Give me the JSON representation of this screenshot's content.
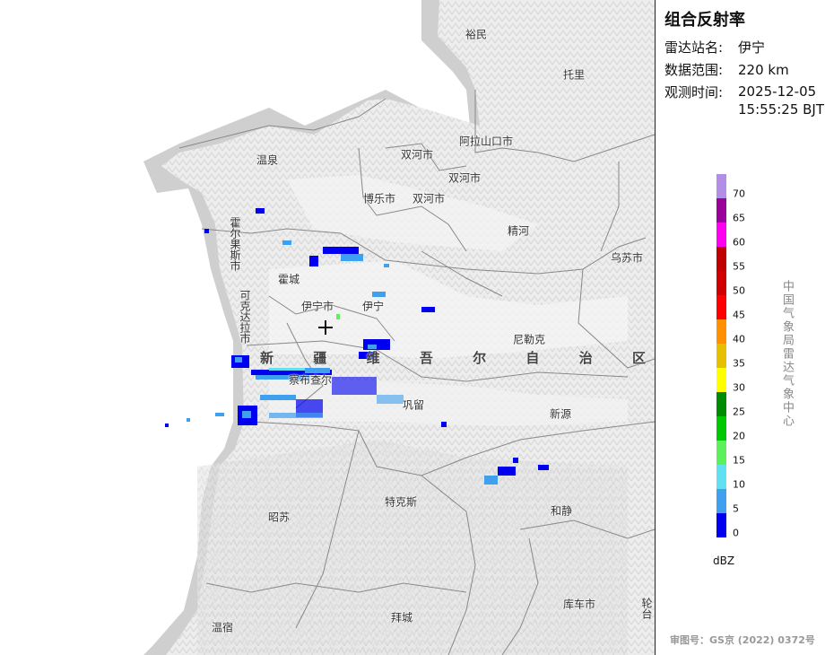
{
  "panel": {
    "title": "组合反射率",
    "station_label": "雷达站名:",
    "station_value": "伊宁",
    "range_label": "数据范围:",
    "range_value": "220 km",
    "time_label": "观测时间:",
    "time_date": "2025-12-05",
    "time_clock": "15:55:25 BJT",
    "unit": "dBZ",
    "organization": "中国气象局雷达气象中心",
    "approval": "审图号：GS京 (2022) 0372号"
  },
  "legend": {
    "ticks": [
      "70",
      "65",
      "60",
      "55",
      "50",
      "45",
      "40",
      "35",
      "30",
      "25",
      "20",
      "15",
      "10",
      "5",
      "0"
    ],
    "colors": [
      "#b28ee6",
      "#9a009a",
      "#ff00f0",
      "#c00000",
      "#d00000",
      "#ff0000",
      "#ff9000",
      "#e6c000",
      "#ffff00",
      "#008c00",
      "#00c800",
      "#5cf05c",
      "#60e0f0",
      "#40a0f0",
      "#0000f0"
    ]
  },
  "map": {
    "places": [
      "裕民",
      "托里",
      "阿拉山口市",
      "双河市",
      "双河市",
      "温泉",
      "博乐市",
      "双河市",
      "精河",
      "乌苏市",
      "霍城",
      "伊宁市",
      "伊宁",
      "尼勒克",
      "察布查尔",
      "巩留",
      "新源",
      "特克斯",
      "昭苏",
      "和静",
      "库车市",
      "拜城",
      "温宿"
    ],
    "vertical_places": [
      "霍尔果斯市",
      "可克达拉市",
      "轮台"
    ],
    "region_chars": [
      "新",
      "疆",
      "维",
      "吾",
      "尔",
      "自",
      "治",
      "区"
    ]
  }
}
